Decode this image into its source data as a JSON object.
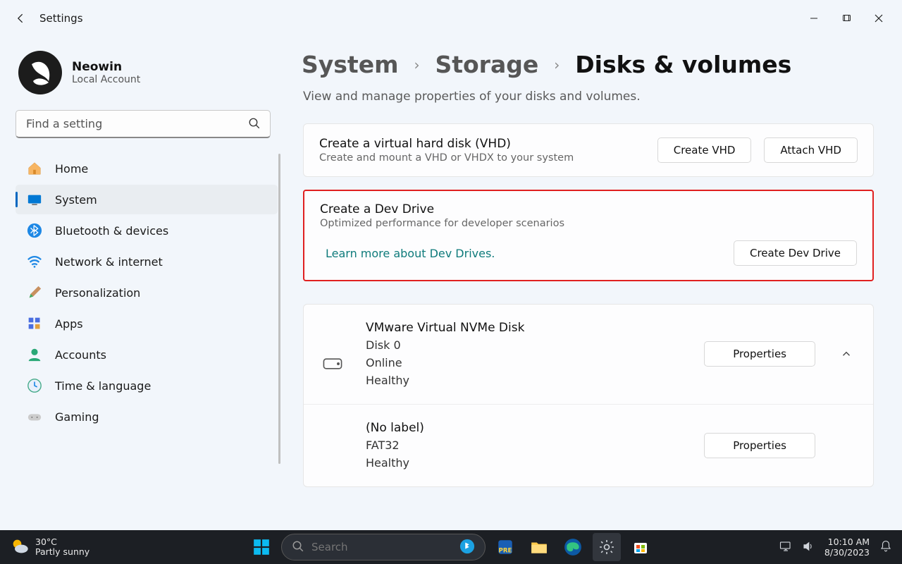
{
  "window": {
    "title": "Settings"
  },
  "user": {
    "name": "Neowin",
    "account_type": "Local Account"
  },
  "search": {
    "placeholder": "Find a setting"
  },
  "nav": {
    "items": [
      {
        "label": "Home"
      },
      {
        "label": "System"
      },
      {
        "label": "Bluetooth & devices"
      },
      {
        "label": "Network & internet"
      },
      {
        "label": "Personalization"
      },
      {
        "label": "Apps"
      },
      {
        "label": "Accounts"
      },
      {
        "label": "Time & language"
      },
      {
        "label": "Gaming"
      }
    ]
  },
  "breadcrumb": {
    "a": "System",
    "b": "Storage",
    "c": "Disks & volumes"
  },
  "subtitle": "View and manage properties of your disks and volumes.",
  "vhd": {
    "title": "Create a virtual hard disk (VHD)",
    "desc": "Create and mount a VHD or VHDX to your system",
    "btn_create": "Create VHD",
    "btn_attach": "Attach VHD"
  },
  "devdrive": {
    "title": "Create a Dev Drive",
    "desc": "Optimized performance for developer scenarios",
    "link": "Learn more about Dev Drives.",
    "btn": "Create Dev Drive"
  },
  "disk0": {
    "title": "VMware Virtual NVMe Disk",
    "line1": "Disk 0",
    "line2": "Online",
    "line3": "Healthy",
    "btn": "Properties"
  },
  "vol0": {
    "title": "(No label)",
    "line1": "FAT32",
    "line2": "Healthy",
    "btn": "Properties"
  },
  "taskbar": {
    "temp": "30°C",
    "weather": "Partly sunny",
    "search_placeholder": "Search",
    "time": "10:10 AM",
    "date": "8/30/2023"
  }
}
